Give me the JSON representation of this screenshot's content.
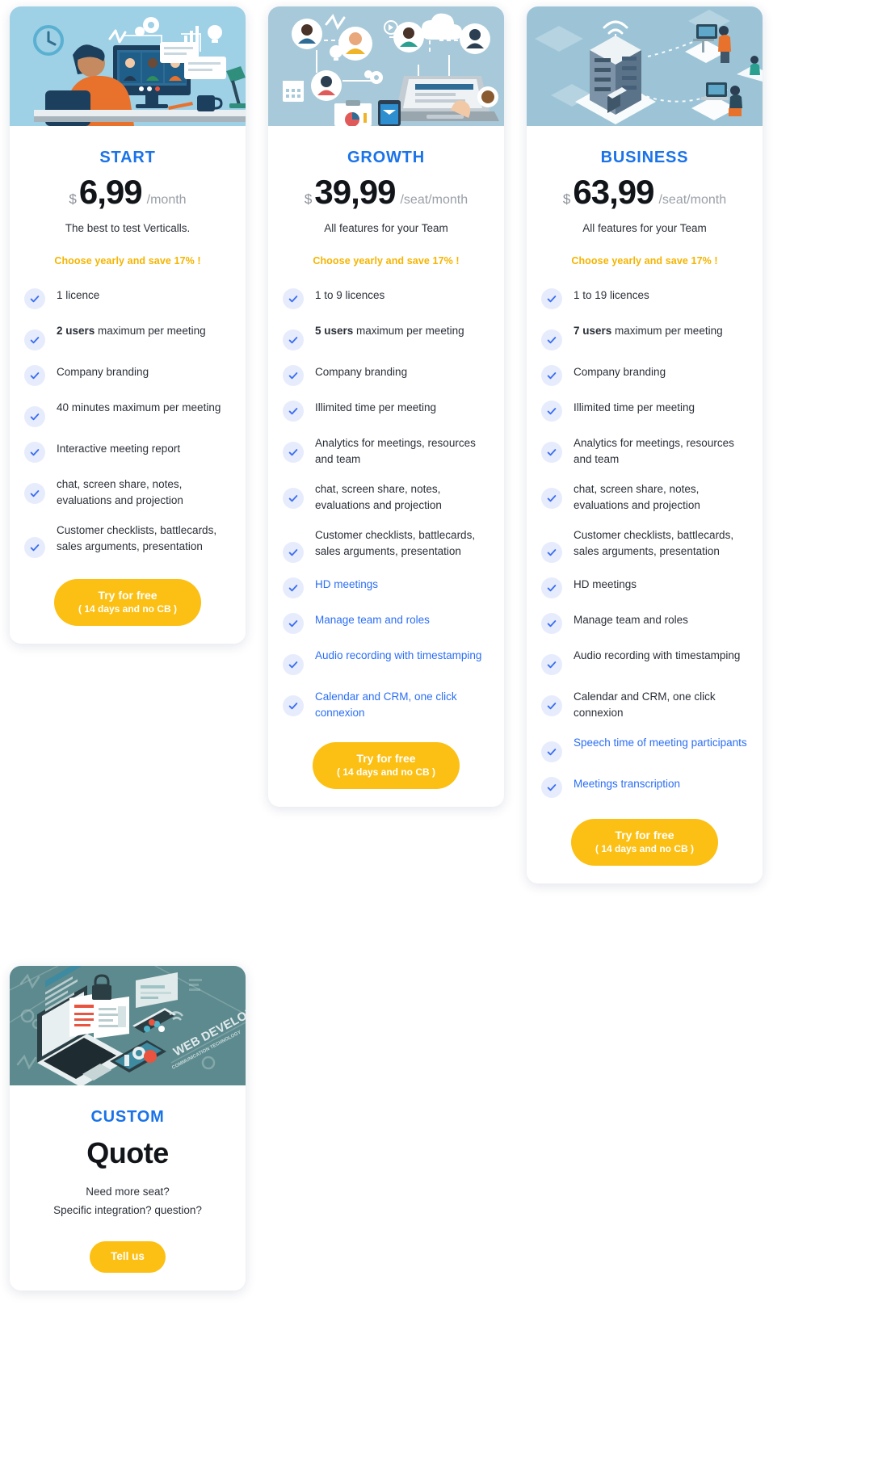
{
  "plans": [
    {
      "id": "start",
      "name": "START",
      "currency": "$",
      "amount": "6,99",
      "period": "/month",
      "tagline": "The best to test Verticalls.",
      "promo": "Choose yearly and save 17% !",
      "hero_icon": "video-conference-illustration",
      "cta": {
        "line1": "Try for free",
        "line2": "( 14 days and no CB )"
      },
      "features": [
        {
          "bold": "",
          "text": "1 licence",
          "highlight": false
        },
        {
          "bold": "2 users",
          "text": " maximum per meeting",
          "highlight": false
        },
        {
          "bold": "",
          "text": "Company branding",
          "highlight": false
        },
        {
          "bold": "",
          "text": "40 minutes maximum per meeting",
          "highlight": false
        },
        {
          "bold": "",
          "text": "Interactive meeting report",
          "highlight": false
        },
        {
          "bold": "",
          "text": "chat, screen share, notes, evaluations and projection",
          "highlight": false
        },
        {
          "bold": "",
          "text": "Customer checklists, battlecards, sales arguments, presentation",
          "highlight": false
        }
      ]
    },
    {
      "id": "growth",
      "name": "GROWTH",
      "currency": "$",
      "amount": "39,99",
      "period": "/seat/month",
      "tagline": "All features for your Team",
      "promo": "Choose yearly and save 17% !",
      "hero_icon": "team-collaboration-illustration",
      "cta": {
        "line1": "Try for free",
        "line2": "( 14 days and no CB )"
      },
      "features": [
        {
          "bold": "",
          "text": "1 to 9 licences",
          "highlight": false
        },
        {
          "bold": "5 users",
          "text": " maximum per meeting",
          "highlight": false
        },
        {
          "bold": "",
          "text": "Company branding",
          "highlight": false
        },
        {
          "bold": "",
          "text": "Illimited time per meeting",
          "highlight": false
        },
        {
          "bold": "",
          "text": "Analytics for meetings, resources and team",
          "highlight": false
        },
        {
          "bold": "",
          "text": "chat, screen share, notes, evaluations and projection",
          "highlight": false
        },
        {
          "bold": "",
          "text": "Customer checklists, battlecards, sales arguments, presentation",
          "highlight": false
        },
        {
          "bold": "",
          "text": "HD meetings",
          "highlight": true
        },
        {
          "bold": "",
          "text": "Manage team and roles",
          "highlight": true
        },
        {
          "bold": "",
          "text": "Audio recording with timestamping",
          "highlight": true
        },
        {
          "bold": "",
          "text": "Calendar and CRM, one click connexion",
          "highlight": true
        }
      ]
    },
    {
      "id": "business",
      "name": "BUSINESS",
      "currency": "$",
      "amount": "63,99",
      "period": "/seat/month",
      "tagline": "All features for your Team",
      "promo": "Choose yearly and save 17% !",
      "hero_icon": "isometric-office-illustration",
      "cta": {
        "line1": "Try for free",
        "line2": "( 14 days and no CB )"
      },
      "features": [
        {
          "bold": "",
          "text": "1 to 19 licences",
          "highlight": false
        },
        {
          "bold": "7 users",
          "text": " maximum per meeting",
          "highlight": false
        },
        {
          "bold": "",
          "text": "Company branding",
          "highlight": false
        },
        {
          "bold": "",
          "text": "Illimited time per meeting",
          "highlight": false
        },
        {
          "bold": "",
          "text": "Analytics for meetings, resources and team",
          "highlight": false
        },
        {
          "bold": "",
          "text": "chat, screen share, notes, evaluations and projection",
          "highlight": false
        },
        {
          "bold": "",
          "text": "Customer checklists, battlecards, sales arguments, presentation",
          "highlight": false
        },
        {
          "bold": "",
          "text": "HD meetings",
          "highlight": false
        },
        {
          "bold": "",
          "text": "Manage team and roles",
          "highlight": false
        },
        {
          "bold": "",
          "text": "Audio recording with timestamping",
          "highlight": false
        },
        {
          "bold": "",
          "text": "Calendar and CRM, one click connexion",
          "highlight": false
        },
        {
          "bold": "",
          "text": "Speech time of meeting participants",
          "highlight": true
        },
        {
          "bold": "",
          "text": "Meetings transcription",
          "highlight": true
        }
      ]
    }
  ],
  "custom": {
    "name": "CUSTOM",
    "title": "Quote",
    "line1": "Need more seat?",
    "line2": "Specific integration? question?",
    "hero_icon": "web-development-illustration",
    "hero_label": "WEB DEVELOPMENT",
    "cta": {
      "label": "Tell us"
    }
  },
  "colors": {
    "accent_blue": "#1a73e8",
    "feature_blue": "#2b6ef5",
    "promo_yellow": "#f5b400",
    "cta_yellow": "#fcc014",
    "check_bg": "#e7ecfd",
    "hero_blue": "#9ed0e6",
    "hero_teal": "#5d8a8e"
  }
}
